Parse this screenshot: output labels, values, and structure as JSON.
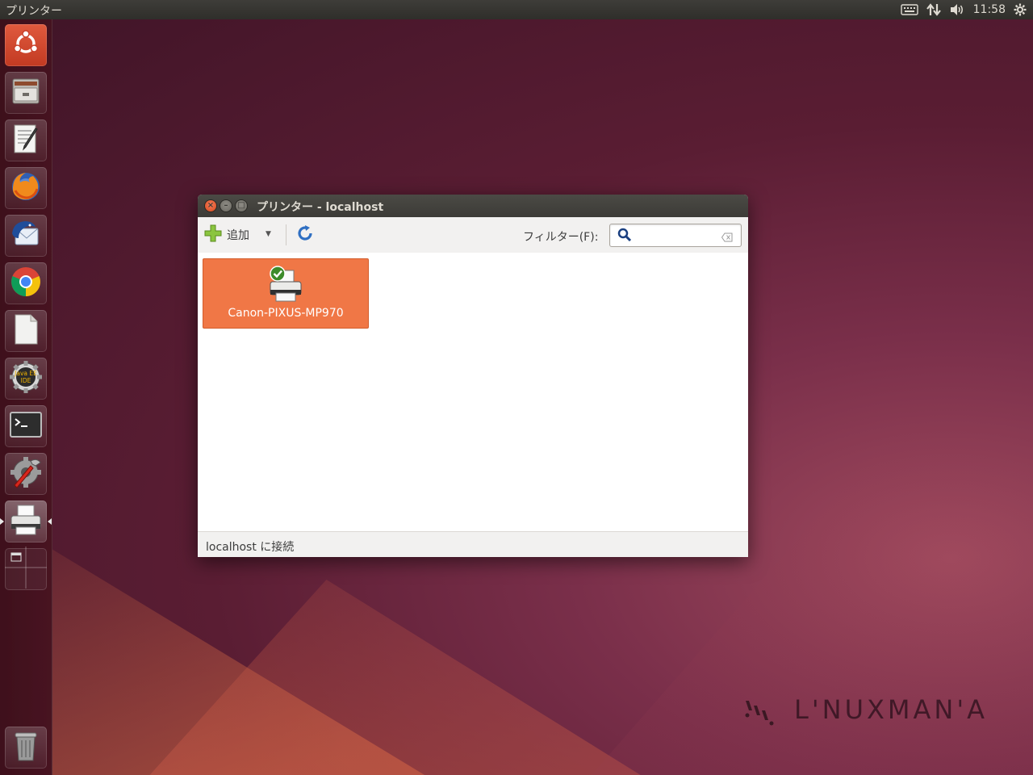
{
  "top_panel": {
    "app_title": "プリンター",
    "clock": "11:58",
    "indicators": [
      "keyboard-icon",
      "network-icon",
      "volume-icon",
      "settings-gear-icon"
    ]
  },
  "launcher": {
    "items": [
      {
        "name": "dash-home",
        "icon": "ubuntu-logo-icon"
      },
      {
        "name": "files",
        "icon": "file-cabinet-icon"
      },
      {
        "name": "text-editor",
        "icon": "text-editor-icon"
      },
      {
        "name": "firefox",
        "icon": "firefox-icon"
      },
      {
        "name": "thunderbird",
        "icon": "thunderbird-icon"
      },
      {
        "name": "chrome",
        "icon": "chrome-icon"
      },
      {
        "name": "libreoffice",
        "icon": "document-icon"
      },
      {
        "name": "java-ee-ide",
        "icon": "java-ee-ide-icon",
        "label": "Java EE IDE"
      },
      {
        "name": "terminal",
        "icon": "terminal-icon"
      },
      {
        "name": "system-settings",
        "icon": "system-settings-icon"
      },
      {
        "name": "printers",
        "icon": "printer-icon",
        "active": true
      },
      {
        "name": "workspace-switcher",
        "icon": "workspace-switcher-icon"
      },
      {
        "name": "trash",
        "icon": "trash-icon"
      }
    ]
  },
  "window": {
    "title": "プリンター - localhost",
    "toolbar": {
      "add_label": "追加",
      "filter_label": "フィルター(F):",
      "search_value": ""
    },
    "printers": [
      {
        "name": "Canon-PIXUS-MP970",
        "status": "default-check"
      }
    ],
    "status_text": "localhost に接続"
  },
  "watermark": {
    "text": "L'NUXMAN'A"
  },
  "colors": {
    "accent": "#f07746",
    "close_button": "#e8582a",
    "panel": "#3c3b37"
  }
}
